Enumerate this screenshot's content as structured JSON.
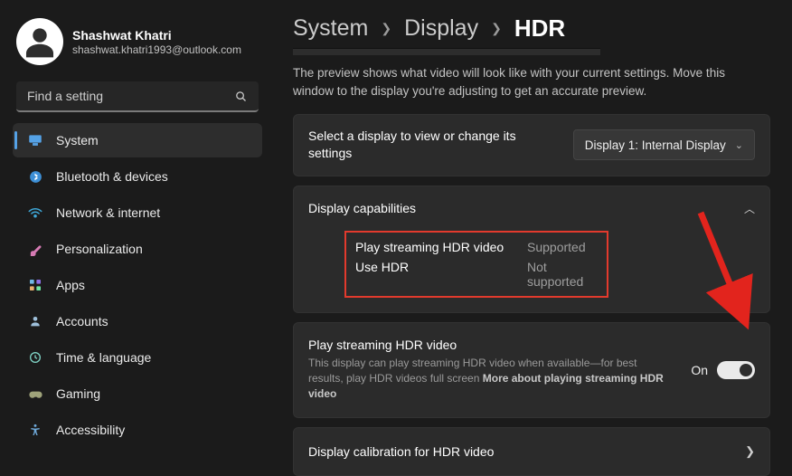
{
  "user": {
    "name": "Shashwat Khatri",
    "email": "shashwat.khatri1993@outlook.com"
  },
  "search": {
    "placeholder": "Find a setting"
  },
  "nav": {
    "system": "System",
    "bluetooth": "Bluetooth & devices",
    "network": "Network & internet",
    "personalization": "Personalization",
    "apps": "Apps",
    "accounts": "Accounts",
    "time": "Time & language",
    "gaming": "Gaming",
    "accessibility": "Accessibility"
  },
  "breadcrumb": {
    "system": "System",
    "display": "Display",
    "hdr": "HDR"
  },
  "preview_text": "The preview shows what video will look like with your current settings. Move this window to the display you're adjusting to get an accurate preview.",
  "display_select": {
    "label": "Select a display to view or change its settings",
    "value": "Display 1: Internal Display"
  },
  "capabilities": {
    "heading": "Display capabilities",
    "rows": {
      "play_label": "Play streaming HDR video",
      "play_value": "Supported",
      "usehdr_label": "Use HDR",
      "usehdr_value": "Not supported"
    }
  },
  "streamhdr": {
    "title": "Play streaming HDR video",
    "desc": "This display can play streaming HDR video when available—for best results, play HDR videos full screen   ",
    "link": "More about playing streaming HDR video",
    "state": "On"
  },
  "calibration": {
    "label": "Display calibration for HDR video"
  }
}
